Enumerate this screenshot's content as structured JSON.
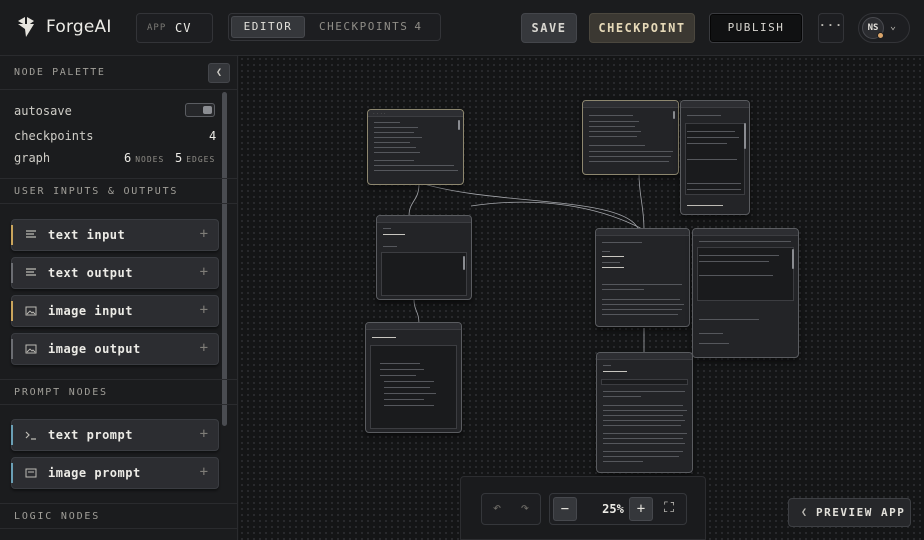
{
  "header": {
    "brand": "ForgeAI",
    "app_label": "APP",
    "app_value": "CV",
    "tabs": {
      "editor": "EDITOR",
      "checkpoints": "CHECKPOINTS",
      "checkpoints_count": "4"
    },
    "buttons": {
      "save": "SAVE",
      "checkpoint": "CHECKPOINT",
      "publish": "PUBLISH",
      "more": "···"
    },
    "user": {
      "initials": "NS",
      "status_color": "#d9a46a"
    }
  },
  "sidebar": {
    "title": "NODE PALETTE",
    "collapse_icon": "chevron-left-icon",
    "stats": {
      "autosave_label": "autosave",
      "autosave_on": true,
      "checkpoints_label": "checkpoints",
      "checkpoints_value": "4",
      "graph_label": "graph",
      "nodes_value": "6",
      "nodes_unit": "NODES",
      "edges_value": "5",
      "edges_unit": "EDGES"
    },
    "sections": [
      {
        "label": "USER INPUTS & OUTPUTS",
        "items": [
          {
            "label": "text input",
            "icon": "text-lines-icon",
            "accent": "#c9a45c"
          },
          {
            "label": "text output",
            "icon": "text-lines-icon",
            "accent": "#6b6d72"
          },
          {
            "label": "image input",
            "icon": "image-icon",
            "accent": "#c9a45c"
          },
          {
            "label": "image output",
            "icon": "image-icon",
            "accent": "#6b6d72"
          }
        ]
      },
      {
        "label": "PROMPT NODES",
        "items": [
          {
            "label": "text prompt",
            "icon": "terminal-icon",
            "accent": "#6a9fb5"
          },
          {
            "label": "image prompt",
            "icon": "image-prompt-icon",
            "accent": "#6a9fb5"
          }
        ]
      },
      {
        "label": "LOGIC NODES",
        "items": []
      }
    ]
  },
  "canvas": {
    "zoom": "25%",
    "undo_icon": "undo-icon",
    "redo_icon": "redo-icon",
    "zoom_out": "−",
    "zoom_in": "+",
    "fit_icon": "fit-screen-icon",
    "preview_label": "PREVIEW APP",
    "node_titles": {
      "run_label": "RUN"
    }
  }
}
